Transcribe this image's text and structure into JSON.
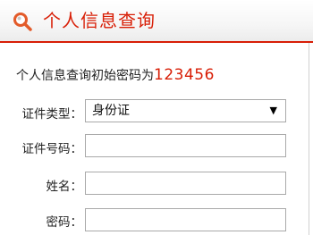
{
  "header": {
    "title": "个人信息查询",
    "icon": "search-icon",
    "accent_color": "#d81e06"
  },
  "info": {
    "text": "个人信息查询初始密码为",
    "password": "123456"
  },
  "form": {
    "id_type_label": "证件类型：",
    "id_type_selected": "身份证",
    "id_number_label": "证件号码：",
    "id_number_value": "",
    "name_label": "姓名：",
    "name_value": "",
    "password_label": "密码：",
    "password_value": ""
  }
}
